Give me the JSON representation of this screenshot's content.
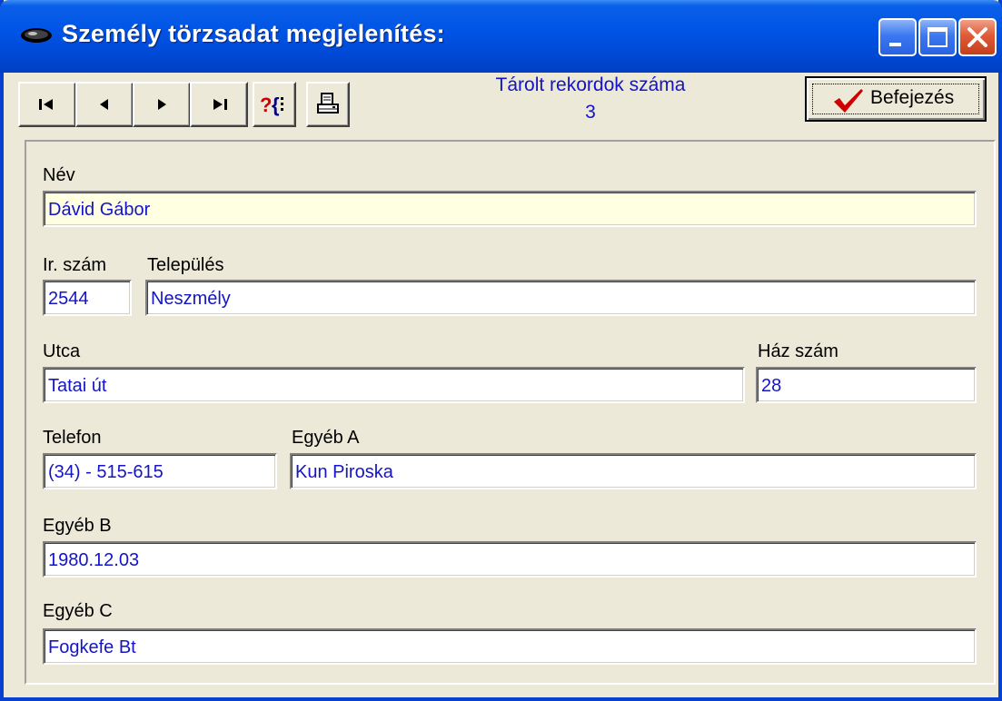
{
  "window": {
    "title": "Személy törzsadat megjelenítés:"
  },
  "toolbar": {
    "nav": [
      "first-record",
      "previous-record",
      "next-record",
      "last-record"
    ],
    "help_icon": "help-braces-icon",
    "print_icon": "printer-icon",
    "record_count_label": "Tárolt rekordok száma",
    "record_count": "3",
    "finish_label": "Befejezés",
    "finish_icon": "checkmark-icon"
  },
  "form": {
    "nev_label": "Név",
    "nev_value": "Dávid Gábor",
    "irszam_label": "Ir. szám",
    "irszam_value": "2544",
    "telepules_label": "Település",
    "telepules_value": "Neszmély",
    "utca_label": "Utca",
    "utca_value": "Tatai út",
    "hazszam_label": "Ház szám",
    "hazszam_value": "28",
    "telefon_label": "Telefon",
    "telefon_value": "(34) - 515-615",
    "egyeba_label": "Egyéb A",
    "egyeba_value": "Kun Piroska",
    "egyebb_label": "Egyéb B",
    "egyebb_value": "1980.12.03",
    "egyebc_label": "Egyéb C",
    "egyebc_value": "Fogkefe Bt"
  },
  "colors": {
    "titlebar": "#0055e6",
    "field_text": "#1414c8",
    "highlight_field": "#ffffe1",
    "window_bg": "#ece9d8"
  }
}
